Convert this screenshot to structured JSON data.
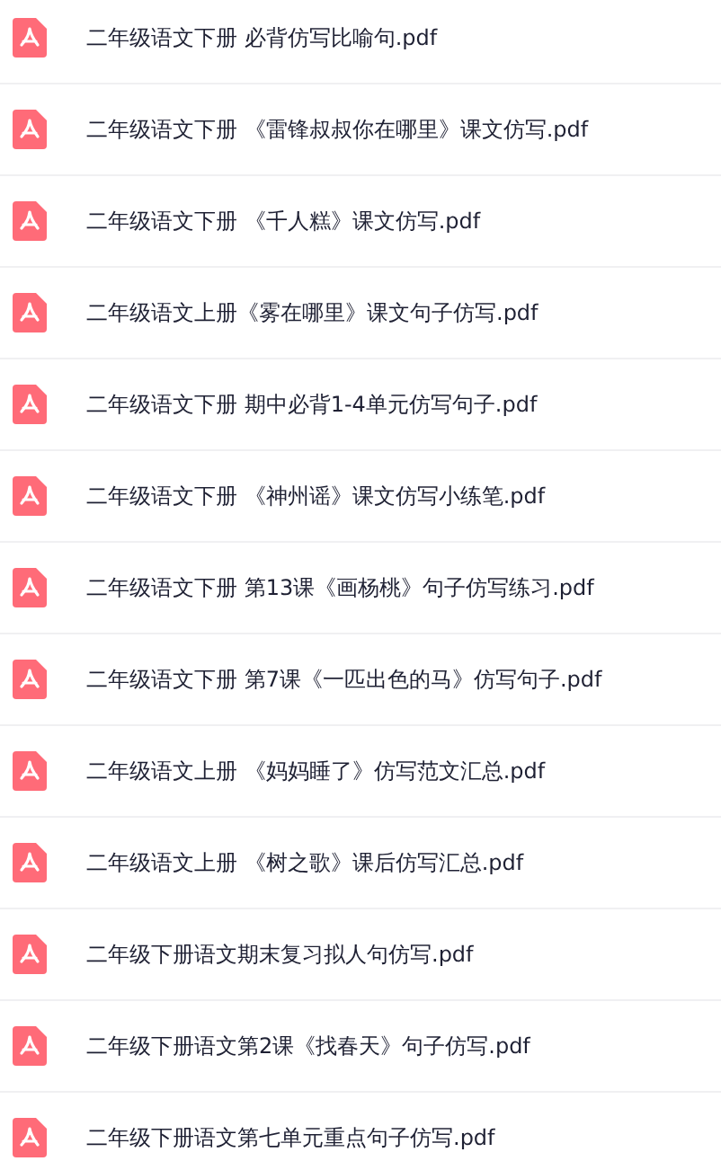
{
  "files": [
    {
      "name": "二年级语文下册 必背仿写比喻句.pdf"
    },
    {
      "name": "二年级语文下册 《雷锋叔叔你在哪里》课文仿写.pdf"
    },
    {
      "name": "二年级语文下册 《千人糕》课文仿写.pdf"
    },
    {
      "name": "二年级语文上册《雾在哪里》课文句子仿写.pdf"
    },
    {
      "name": "二年级语文下册 期中必背1-4单元仿写句子.pdf"
    },
    {
      "name": "二年级语文下册 《神州谣》课文仿写小练笔.pdf"
    },
    {
      "name": "二年级语文下册 第13课《画杨桃》句子仿写练习.pdf"
    },
    {
      "name": "二年级语文下册 第7课《一匹出色的马》仿写句子.pdf"
    },
    {
      "name": "二年级语文上册 《妈妈睡了》仿写范文汇总.pdf"
    },
    {
      "name": "二年级语文上册 《树之歌》课后仿写汇总.pdf"
    },
    {
      "name": "二年级下册语文期末复习拟人句仿写.pdf"
    },
    {
      "name": "二年级下册语文第2课《找春天》句子仿写.pdf"
    },
    {
      "name": "二年级下册语文第七单元重点句子仿写.pdf"
    }
  ]
}
